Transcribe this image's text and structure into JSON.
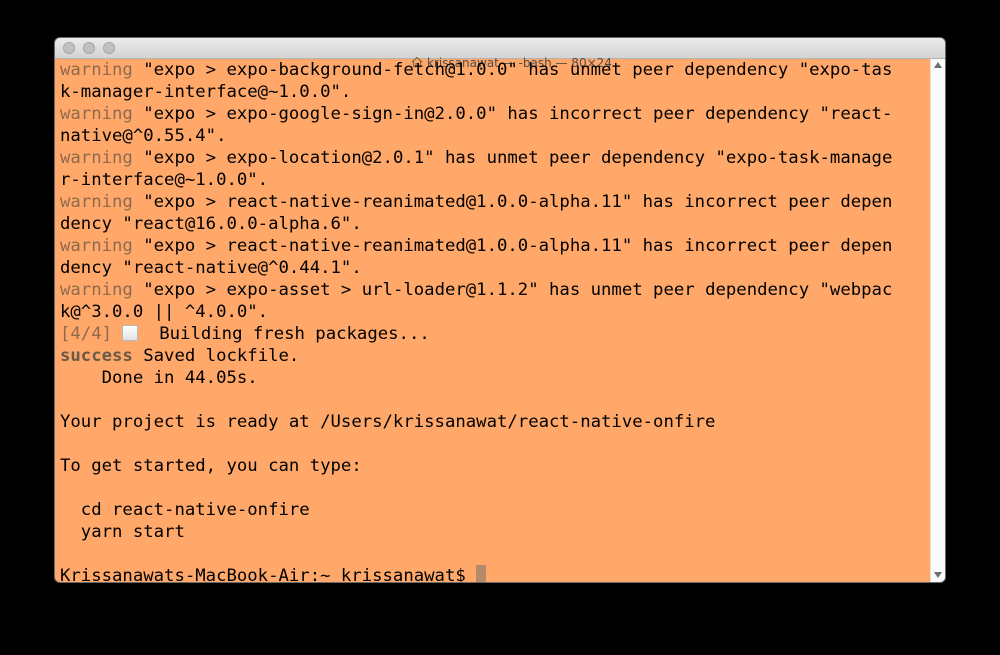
{
  "window": {
    "title": "krissanawat — -bash — 80×24"
  },
  "colors": {
    "background": "#ffa86a",
    "warning": "#8f6a4d",
    "success": "#6b5a45",
    "cursor": "#b38a6a"
  },
  "terminal": {
    "lines": [
      {
        "prefix": "warning",
        "text": " \"expo > expo-background-fetch@1.0.0\" has unmet peer dependency \"expo-tas"
      },
      {
        "prefix": "",
        "text": "k-manager-interface@~1.0.0\"."
      },
      {
        "prefix": "warning",
        "text": " \"expo > expo-google-sign-in@2.0.0\" has incorrect peer dependency \"react-"
      },
      {
        "prefix": "",
        "text": "native@^0.55.4\"."
      },
      {
        "prefix": "warning",
        "text": " \"expo > expo-location@2.0.1\" has unmet peer dependency \"expo-task-manage"
      },
      {
        "prefix": "",
        "text": "r-interface@~1.0.0\"."
      },
      {
        "prefix": "warning",
        "text": " \"expo > react-native-reanimated@1.0.0-alpha.11\" has incorrect peer depen"
      },
      {
        "prefix": "",
        "text": "dency \"react@16.0.0-alpha.6\"."
      },
      {
        "prefix": "warning",
        "text": " \"expo > react-native-reanimated@1.0.0-alpha.11\" has incorrect peer depen"
      },
      {
        "prefix": "",
        "text": "dency \"react-native@^0.44.1\"."
      },
      {
        "prefix": "warning",
        "text": " \"expo > expo-asset > url-loader@1.1.2\" has unmet peer dependency \"webpac"
      },
      {
        "prefix": "",
        "text": "k@^3.0.0 || ^4.0.0\"."
      }
    ],
    "step": {
      "prefix": "[4/4]",
      "icon": "package-icon",
      "text": "  Building fresh packages..."
    },
    "success": {
      "prefix": "success",
      "text": " Saved lockfile."
    },
    "done": "    Done in 44.05s.",
    "ready": "Your project is ready at /Users/krissanawat/react-native-onfire",
    "get_started": "To get started, you can type:",
    "cmd1": "  cd react-native-onfire",
    "cmd2": "  yarn start",
    "prompt": "Krissanawats-MacBook-Air:~ krissanawat$ "
  }
}
